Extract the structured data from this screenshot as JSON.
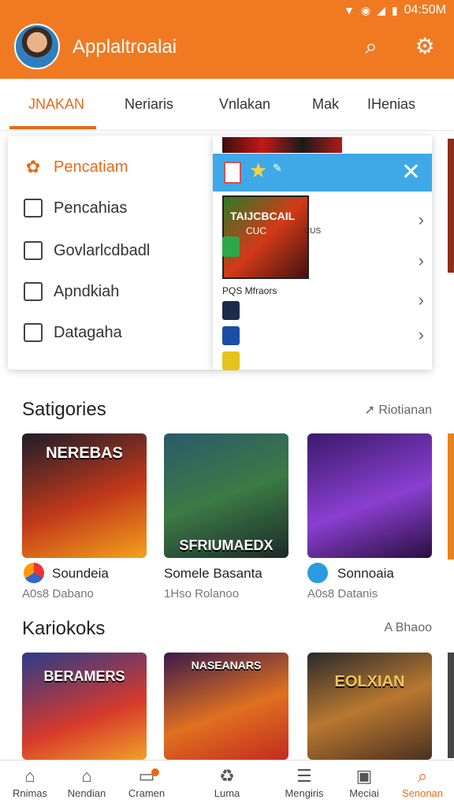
{
  "status": {
    "time": "04:50M"
  },
  "header": {
    "title": "Applaltroalai"
  },
  "tabs": [
    "JNAKAN",
    "Neriaris",
    "Vnlakan",
    "Mak",
    "IHenias"
  ],
  "dropdown": {
    "items": [
      {
        "label": "Pencatiam",
        "icon": "flower-icon"
      },
      {
        "label": "Pencahias",
        "icon": "image-icon"
      },
      {
        "label": "Govlarlcdbadl",
        "icon": "edit-icon"
      },
      {
        "label": "Apndkiah",
        "icon": "checkbox-icon"
      },
      {
        "label": "Datagaha",
        "icon": "edit-box-icon"
      }
    ]
  },
  "popup": {
    "game_title": "TAIJCBCAIL",
    "game_subtitle": "CUC",
    "game_tag": "CUS",
    "list_label": "PQS Mfraors"
  },
  "section1": {
    "title": "Satigories",
    "more": "Riotianan",
    "cards": [
      {
        "art_text": "NEREBAS",
        "name": "Soundeia",
        "sub": "A0s8 Dabano"
      },
      {
        "art_text": "SFRIUMAEDX",
        "name": "Somele Basanta",
        "sub": "1Hso Rolanoo"
      },
      {
        "art_text": "",
        "name": "Sonnoaia",
        "sub": "A0s8 Datanis"
      }
    ]
  },
  "section2": {
    "title": "Kariokoks",
    "more": "A Bhaoo",
    "cards": [
      {
        "art_text": "BERAMERS"
      },
      {
        "art_text": "NASEANARS"
      },
      {
        "art_text": "EOLXIAN"
      }
    ]
  },
  "bottom_nav": [
    {
      "label": "Rnimas",
      "icon": "home-icon"
    },
    {
      "label": "Nendian",
      "icon": "house-icon"
    },
    {
      "label": "Cramen",
      "icon": "chat-icon"
    },
    {
      "label": "Luma",
      "icon": "recycle-icon"
    },
    {
      "label": "Mengiris",
      "icon": "list-icon"
    },
    {
      "label": "Meciai",
      "icon": "bag-icon"
    },
    {
      "label": "Senonan",
      "icon": "search-icon"
    }
  ],
  "colors": {
    "accent": "#f07a22",
    "popup_header": "#3ea9e6"
  }
}
